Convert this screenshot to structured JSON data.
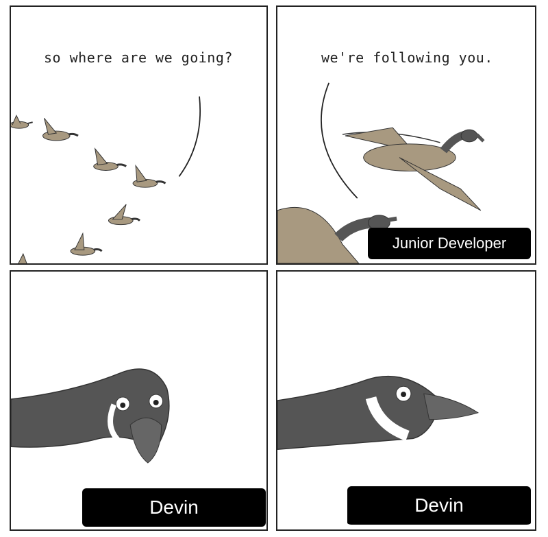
{
  "panels": {
    "p1": {
      "speech": "so where are we going?"
    },
    "p2": {
      "speech": "we're following you.",
      "label": "Junior Developer"
    },
    "p3": {
      "label": "Devin"
    },
    "p4": {
      "label": "Devin"
    }
  },
  "colors": {
    "border": "#222222",
    "goose_neck": "#555555",
    "goose_body": "#a89980",
    "cheek": "#ffffff",
    "label_bg": "#000000",
    "label_text": "#ffffff"
  }
}
